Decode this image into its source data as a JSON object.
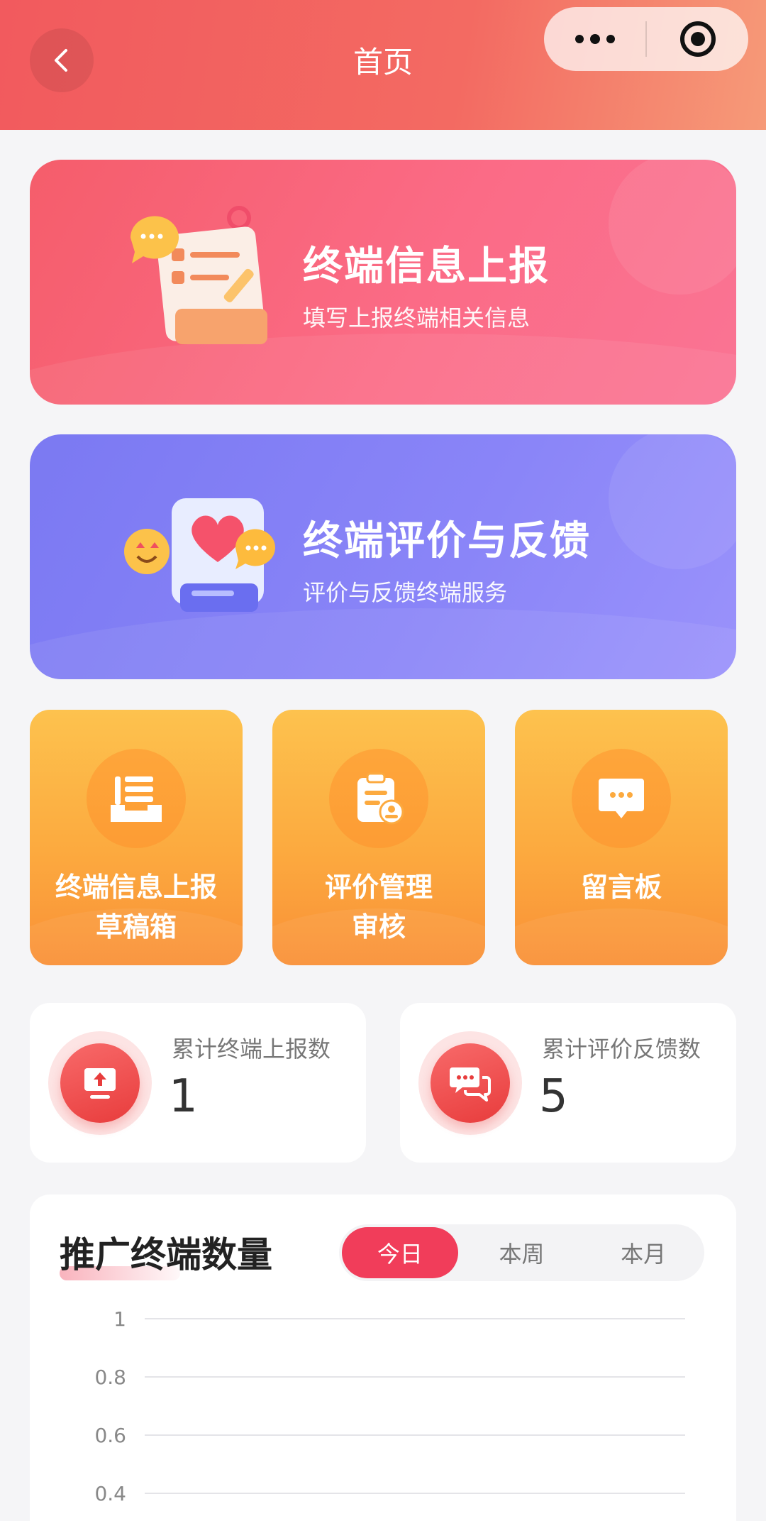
{
  "header": {
    "title": "首页"
  },
  "banners": [
    {
      "title": "终端信息上报",
      "subtitle": "填写上报终端相关信息"
    },
    {
      "title": "终端评价与反馈",
      "subtitle": "评价与反馈终端服务"
    }
  ],
  "tiles": [
    {
      "line1": "终端信息上报",
      "line2": "草稿箱",
      "icon": "inbox-icon"
    },
    {
      "line1": "评价管理",
      "line2": "审核",
      "icon": "clipboard-review-icon"
    },
    {
      "line1": "留言板",
      "line2": "",
      "icon": "message-board-icon"
    }
  ],
  "stats": [
    {
      "label": "累计终端上报数",
      "value": "1",
      "icon": "upload-monitor-icon"
    },
    {
      "label": "累计评价反馈数",
      "value": "5",
      "icon": "chat-bubbles-icon"
    }
  ],
  "chart_section": {
    "title": "推广终端数量",
    "tabs": [
      "今日",
      "本周",
      "本月"
    ],
    "active_tab": "今日"
  },
  "chart_data": {
    "type": "line",
    "title": "",
    "y_ticks": [
      "1",
      "0.8",
      "0.6",
      "0.4"
    ],
    "ylim": [
      0.4,
      1
    ],
    "grid": true
  },
  "colors": {
    "header": "#f25a5e",
    "banner_red": "#f55d6b",
    "banner_blue": "#7b79f2",
    "tile_orange": "#fcaa3f",
    "accent": "#f13d5a"
  }
}
